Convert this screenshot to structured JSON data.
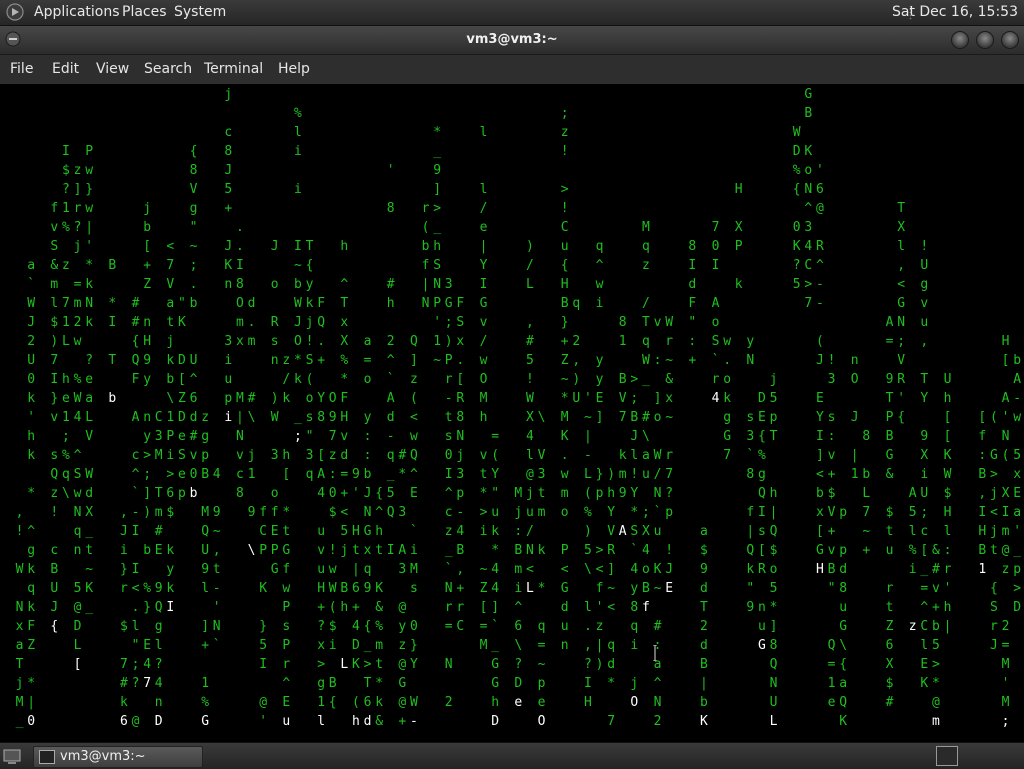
{
  "top_panel": {
    "menus": [
      "Applications",
      "Places",
      "System"
    ],
    "clock": "Sat Dec 16, 15:53"
  },
  "window": {
    "title": "vm3@vm3:~"
  },
  "menu_bar": {
    "items": [
      "File",
      "Edit",
      "View",
      "Search",
      "Terminal",
      "Help"
    ]
  },
  "terminal": {
    "program": "cmatrix",
    "text_color": "#1fbf1f",
    "highlight_color": "#ffffff",
    "background": "#000000"
  },
  "taskbar": {
    "task_label": "vm3@vm3:~"
  },
  "icons": {
    "distro": "distro-logo-icon",
    "show_desktop": "show-desktop-icon",
    "task": "terminal-icon",
    "tray": "terminal-tray-icon",
    "cursor": "text-cursor-icon"
  }
}
